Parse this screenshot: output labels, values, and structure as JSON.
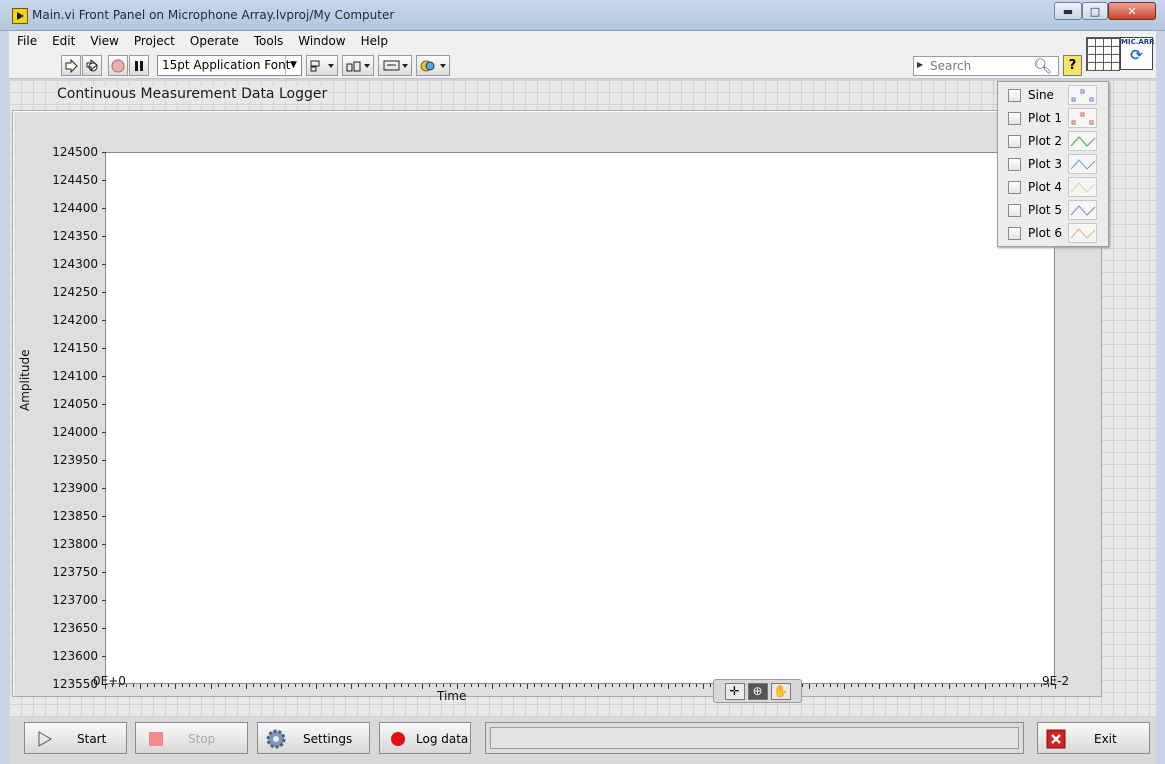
{
  "window": {
    "title": "Main.vi Front Panel on Microphone Array.lvproj/My Computer",
    "min_glyph": "▬",
    "max_glyph": "□",
    "close_glyph": "✕"
  },
  "menu": [
    "File",
    "Edit",
    "View",
    "Project",
    "Operate",
    "Tools",
    "Window",
    "Help"
  ],
  "toolbar": {
    "font": "15pt Application Font",
    "search_placeholder": "Search",
    "help": "?",
    "vi_icon_label": "MIC.ARR"
  },
  "graph": {
    "label": "Continuous Measurement Data Logger",
    "x_title": "Time",
    "y_title": "Amplitude",
    "x_min_label": "0E+0",
    "x_max_label": "9E-2",
    "y_ticks": [
      "124500",
      "124450",
      "124400",
      "124350",
      "124300",
      "124250",
      "124200",
      "124150",
      "124100",
      "124050",
      "124000",
      "123950",
      "123900",
      "123850",
      "123800",
      "123750",
      "123700",
      "123650",
      "123600",
      "123550"
    ]
  },
  "legend": [
    {
      "name": "Sine",
      "color": "#5b7fd1"
    },
    {
      "name": "Plot 1",
      "color": "#d9534f"
    },
    {
      "name": "Plot 2",
      "color": "#3cb043"
    },
    {
      "name": "Plot 3",
      "color": "#5fa8c9"
    },
    {
      "name": "Plot 4",
      "color": "#e8d77b"
    },
    {
      "name": "Plot 5",
      "color": "#9b7fc8"
    },
    {
      "name": "Plot 6",
      "color": "#e0b46a"
    }
  ],
  "buttons": {
    "start": "Start",
    "stop": "Stop",
    "settings": "Settings",
    "log": "Log data",
    "exit": "Exit"
  },
  "chart_data": {
    "type": "line",
    "xlabel": "Time",
    "ylabel": "Amplitude",
    "xlim": [
      0,
      0.09
    ],
    "ylim": [
      123550,
      124500
    ],
    "series": []
  }
}
